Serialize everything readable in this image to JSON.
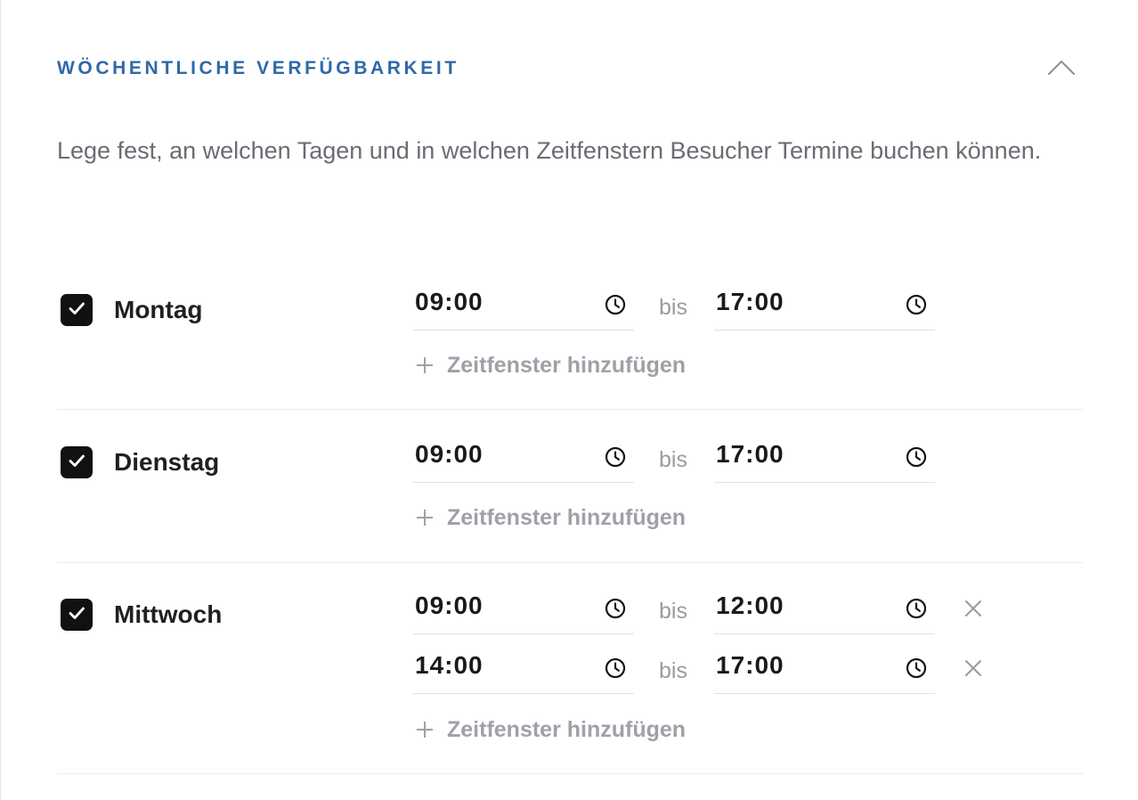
{
  "section": {
    "title": "WÖCHENTLICHE VERFÜGBARKEIT",
    "description": "Lege fest, an welchen Tagen und in welchen Zeitfenstern Besucher Termine buchen können."
  },
  "days": [
    {
      "label": "Montag",
      "checked": true,
      "slots": [
        {
          "from": "09:00",
          "sep": "bis",
          "to": "17:00"
        }
      ],
      "add_label": "Zeitfenster hinzufügen"
    },
    {
      "label": "Dienstag",
      "checked": true,
      "slots": [
        {
          "from": "09:00",
          "sep": "bis",
          "to": "17:00"
        }
      ],
      "add_label": "Zeitfenster hinzufügen"
    },
    {
      "label": "Mittwoch",
      "checked": true,
      "slots": [
        {
          "from": "09:00",
          "sep": "bis",
          "to": "12:00"
        },
        {
          "from": "14:00",
          "sep": "bis",
          "to": "17:00"
        }
      ],
      "add_label": "Zeitfenster hinzufügen"
    }
  ],
  "icons": {
    "collapse": "chevron-up-icon",
    "checkbox": "check-icon",
    "time": "clock-icon",
    "remove": "close-icon",
    "add": "plus-icon"
  },
  "colors": {
    "title": "#2f68a8",
    "checkbox": "#111114",
    "muted": "#a0a0a8"
  }
}
